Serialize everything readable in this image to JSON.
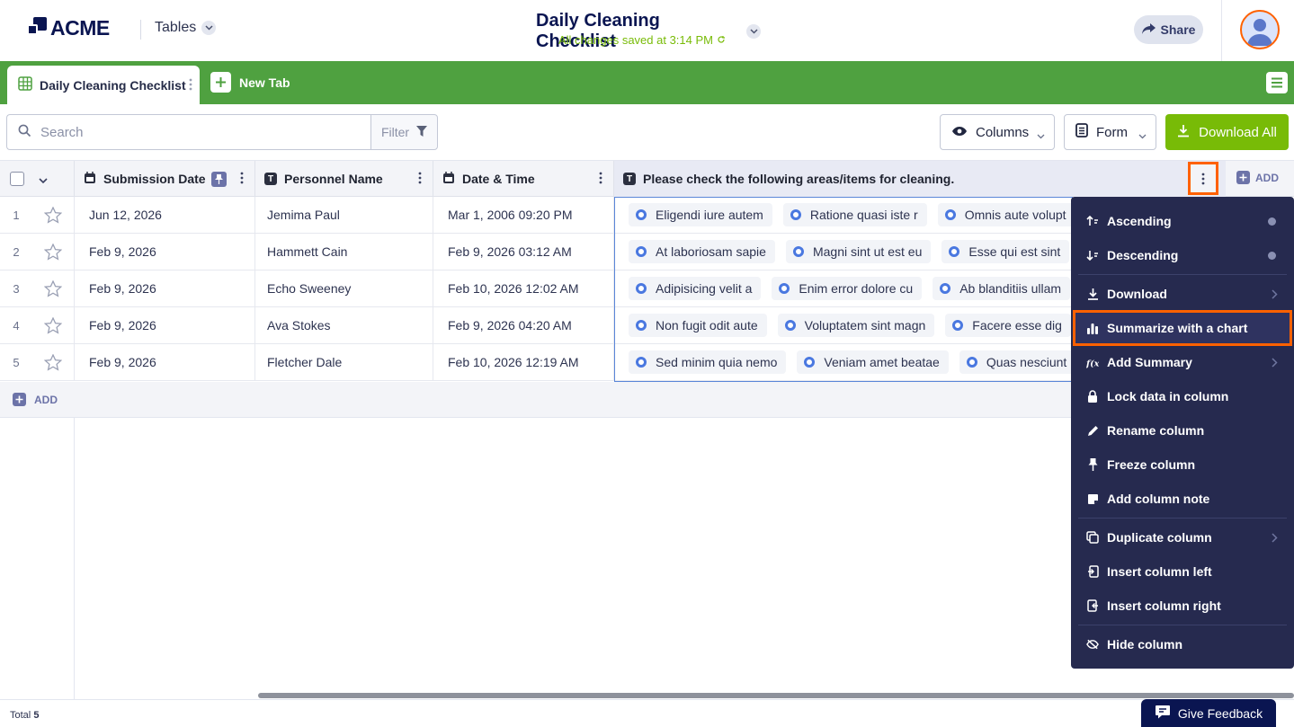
{
  "header": {
    "brand": "ACME",
    "tables_label": "Tables",
    "doc_title": "Daily Cleaning Checklist",
    "saved_status": "All changes saved at 3:14 PM",
    "share_label": "Share"
  },
  "tabs": {
    "active_label": "Daily Cleaning Checklist",
    "new_tab_label": "New Tab"
  },
  "toolbar": {
    "search_placeholder": "Search",
    "filter_label": "Filter",
    "columns_label": "Columns",
    "form_label": "Form",
    "download_all_label": "Download All"
  },
  "columns": [
    {
      "name": "Submission Date",
      "icon": "calendar-icon"
    },
    {
      "name": "Personnel Name",
      "icon": "text-icon"
    },
    {
      "name": "Date & Time",
      "icon": "calendar-icon"
    },
    {
      "name": "Please check the following areas/items for cleaning.",
      "icon": "text-icon"
    }
  ],
  "add_column_label": "ADD",
  "rows": [
    {
      "num": "1",
      "submission": "Jun 12, 2026",
      "name": "Jemima Paul",
      "datetime": "Mar 1, 2006 09:20 PM",
      "items": [
        "Eligendi iure autem",
        "Ratione quasi iste r",
        "Omnis aute volupt"
      ]
    },
    {
      "num": "2",
      "submission": "Feb 9, 2026",
      "name": "Hammett Cain",
      "datetime": "Feb 9, 2026 03:12 AM",
      "items": [
        "At laboriosam sapie",
        "Magni sint ut est eu",
        "Esse qui est sint"
      ]
    },
    {
      "num": "3",
      "submission": "Feb 9, 2026",
      "name": "Echo Sweeney",
      "datetime": "Feb 10, 2026 12:02 AM",
      "items": [
        "Adipisicing velit a",
        "Enim error dolore cu",
        "Ab blanditiis ullam"
      ]
    },
    {
      "num": "4",
      "submission": "Feb 9, 2026",
      "name": "Ava Stokes",
      "datetime": "Feb 9, 2026 04:20 AM",
      "items": [
        "Non fugit odit aute",
        "Voluptatem sint magn",
        "Facere esse dig"
      ]
    },
    {
      "num": "5",
      "submission": "Feb 9, 2026",
      "name": "Fletcher Dale",
      "datetime": "Feb 10, 2026 12:19 AM",
      "items": [
        "Sed minim quia nemo",
        "Veniam amet beatae",
        "Quas nesciunt"
      ]
    }
  ],
  "add_row_label": "ADD",
  "footer": {
    "total_label": "Total",
    "total_count": "5",
    "feedback_label": "Give Feedback"
  },
  "column_menu": {
    "items": [
      {
        "label": "Ascending",
        "icon": "sort-ascending-icon"
      },
      {
        "label": "Descending",
        "icon": "sort-descending-icon"
      },
      {
        "label": "Download",
        "icon": "download-icon"
      },
      {
        "label": "Summarize with a chart",
        "icon": "bar-chart-icon"
      },
      {
        "label": "Add Summary",
        "icon": "function-icon"
      },
      {
        "label": "Lock data in column",
        "icon": "lock-icon"
      },
      {
        "label": "Rename column",
        "icon": "pencil-icon"
      },
      {
        "label": "Freeze column",
        "icon": "pin-icon"
      },
      {
        "label": "Add column note",
        "icon": "note-icon"
      },
      {
        "label": "Duplicate column",
        "icon": "duplicate-icon"
      },
      {
        "label": "Insert column left",
        "icon": "insert-left-icon"
      },
      {
        "label": "Insert column right",
        "icon": "insert-right-icon"
      },
      {
        "label": "Hide column",
        "icon": "eye-off-icon"
      }
    ]
  },
  "colors": {
    "brand_navy": "#0a1551",
    "tab_green": "#4fa140",
    "download_green": "#78bb07",
    "menu_bg": "#262a4f",
    "highlight_orange": "#ff6100"
  }
}
